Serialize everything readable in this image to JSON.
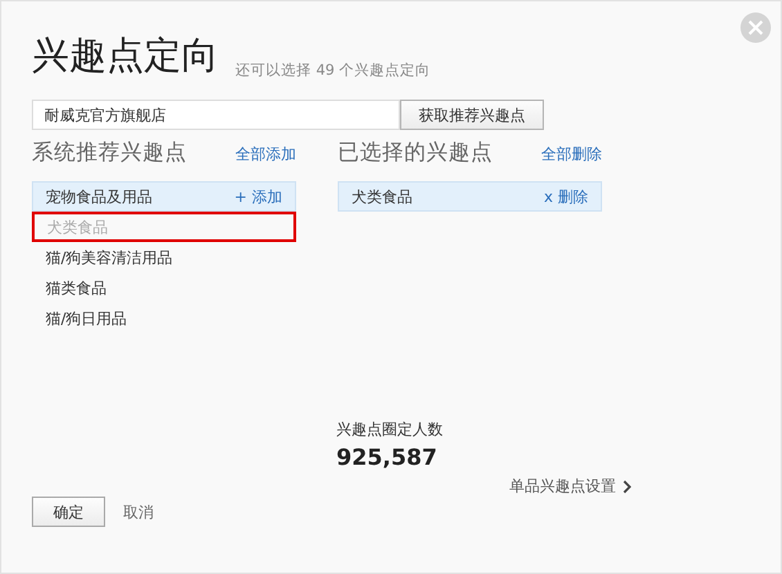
{
  "dialog": {
    "title": "兴趣点定向",
    "subtitle": "还可以选择 49 个兴趣点定向"
  },
  "search": {
    "value": "耐威克官方旗舰店",
    "button": "获取推荐兴趣点"
  },
  "recommended": {
    "heading": "系统推荐兴趣点",
    "action": "全部添加",
    "items": [
      {
        "kind": "category",
        "label": "宠物食品及用品",
        "action": "+ 添加",
        "disabled": false,
        "highlighted": false
      },
      {
        "kind": "item",
        "label": "犬类食品",
        "disabled": true,
        "highlighted": true
      },
      {
        "kind": "item",
        "label": "猫/狗美容清洁用品",
        "disabled": false,
        "highlighted": false
      },
      {
        "kind": "item",
        "label": "猫类食品",
        "disabled": false,
        "highlighted": false
      },
      {
        "kind": "item",
        "label": "猫/狗日用品",
        "disabled": false,
        "highlighted": false
      }
    ]
  },
  "chosen": {
    "heading": "已选择的兴趣点",
    "action": "全部删除",
    "items": [
      {
        "label": "犬类食品",
        "action": "x 删除"
      }
    ]
  },
  "audience": {
    "label": "兴趣点圈定人数",
    "value": "925,587",
    "link": "单品兴趣点设置"
  },
  "buttons": {
    "ok": "确定",
    "cancel": "取消"
  }
}
